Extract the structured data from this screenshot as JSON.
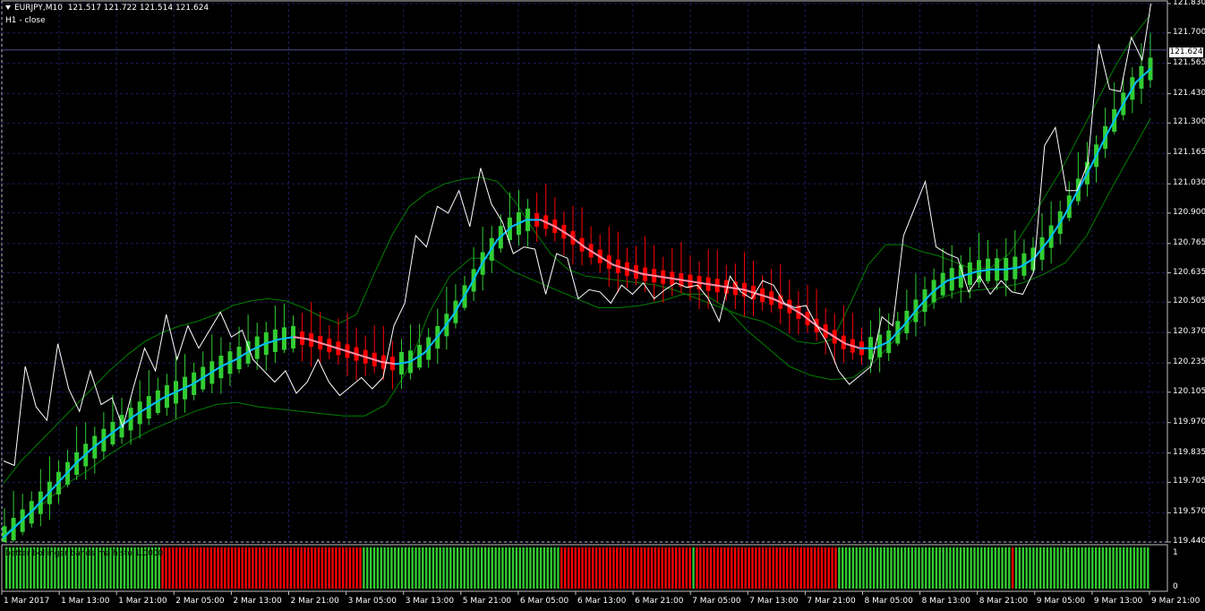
{
  "header": {
    "symbol_line": "EURJPY,M10  121.517 121.722 121.514 121.624",
    "overlay_label": "H1 - close"
  },
  "subwindow": {
    "label": "better bollinger bands ma histo  1.0000",
    "scale_top": "1",
    "scale_bottom": "0"
  },
  "current_price": "121.624",
  "colors": {
    "background": "#000000",
    "grid": "#1c1c5a",
    "bull": "#32cd32",
    "bear": "#ff0000",
    "ma_up": "#00bfff",
    "ma_down": "#ff8fa8",
    "bands": "#008000",
    "close_line": "#ffffff",
    "histo_up": "#32cd32",
    "histo_down": "#ff0000"
  },
  "chart_data": {
    "type": "line",
    "title": "EURJPY,M10",
    "xlabel": "",
    "ylabel": "",
    "ylim": [
      119.44,
      121.83
    ],
    "yticks": [
      "121.830",
      "121.700",
      "121.565",
      "121.430",
      "121.300",
      "121.165",
      "121.030",
      "120.900",
      "120.765",
      "120.635",
      "120.505",
      "120.370",
      "120.235",
      "120.105",
      "119.970",
      "119.835",
      "119.705",
      "119.570",
      "119.440"
    ],
    "xticks": [
      "1 Mar 2017",
      "1 Mar 13:00",
      "1 Mar 21:00",
      "2 Mar 05:00",
      "2 Mar 13:00",
      "2 Mar 21:00",
      "3 Mar 05:00",
      "3 Mar 13:00",
      "5 Mar 21:00",
      "6 Mar 05:00",
      "6 Mar 13:00",
      "6 Mar 21:00",
      "7 Mar 05:00",
      "7 Mar 13:00",
      "7 Mar 21:00",
      "8 Mar 05:00",
      "8 Mar 13:00",
      "8 Mar 21:00",
      "9 Mar 05:00",
      "9 Mar 13:00",
      "9 Mar 21:00"
    ],
    "grid": true,
    "series": [
      {
        "name": "H1 - close",
        "values": [
          119.8,
          119.78,
          120.22,
          120.04,
          119.98,
          120.32,
          120.12,
          120.02,
          120.2,
          120.05,
          120.08,
          119.95,
          120.13,
          120.3,
          120.2,
          120.45,
          120.25,
          120.4,
          120.3,
          120.38,
          120.46,
          120.35,
          120.38,
          120.25,
          120.2,
          120.15,
          120.2,
          120.1,
          120.15,
          120.25,
          120.15,
          120.09,
          120.13,
          120.17,
          120.12,
          120.17,
          120.4,
          120.5,
          120.8,
          120.75,
          120.93,
          120.9,
          121.0,
          120.84,
          121.1,
          120.94,
          120.86,
          120.72,
          120.75,
          120.74,
          120.54,
          120.72,
          120.7,
          120.52,
          120.56,
          120.55,
          120.5,
          120.58,
          120.54,
          120.59,
          120.52,
          120.56,
          120.59,
          120.57,
          120.58,
          120.52,
          120.42,
          120.62,
          120.55,
          120.52,
          120.6,
          120.58,
          120.5,
          120.48,
          120.49,
          120.4,
          120.32,
          120.2,
          120.14,
          120.18,
          120.22,
          120.44,
          120.4,
          120.8,
          120.92,
          121.04,
          120.75,
          120.72,
          120.7,
          120.55,
          120.62,
          120.54,
          120.6,
          120.55,
          120.54,
          120.64,
          121.2,
          121.28,
          121.0,
          121.0,
          121.12,
          121.65,
          121.45,
          121.44,
          121.68,
          121.58,
          121.89,
          121.85
        ]
      },
      {
        "name": "",
        "values": [
          119.46,
          119.52,
          119.58,
          119.65,
          119.72,
          119.79,
          119.85,
          119.9,
          119.95,
          120.0,
          120.04,
          120.08,
          120.11,
          120.14,
          120.18,
          120.22,
          120.25,
          120.29,
          120.32,
          120.34,
          120.35,
          120.34,
          120.32,
          120.3,
          120.28,
          120.26,
          120.24,
          120.23,
          120.24,
          120.28,
          120.36,
          120.45,
          120.56,
          120.68,
          120.78,
          120.84,
          120.87,
          120.87,
          120.84,
          120.8,
          120.75,
          120.71,
          120.67,
          120.65,
          120.63,
          120.62,
          120.61,
          120.6,
          120.59,
          120.58,
          120.57,
          120.56,
          120.54,
          120.52,
          120.49,
          120.45,
          120.4,
          120.36,
          120.32,
          120.3,
          120.3,
          120.33,
          120.4,
          120.48,
          120.55,
          120.6,
          120.62,
          120.64,
          120.65,
          120.65,
          120.66,
          120.7,
          120.78,
          120.88,
          121.0,
          121.12,
          121.25,
          121.37,
          121.48,
          121.54
        ]
      },
      {
        "name": "",
        "values": [
          119.7,
          119.8,
          119.88,
          119.96,
          120.04,
          120.12,
          120.2,
          120.27,
          120.33,
          120.37,
          120.4,
          120.42,
          120.45,
          120.49,
          120.51,
          120.52,
          120.51,
          120.48,
          120.44,
          120.41,
          120.45,
          120.63,
          120.8,
          120.93,
          120.99,
          121.03,
          121.05,
          121.06,
          121.04,
          120.95,
          120.83,
          120.72,
          120.65,
          120.62,
          120.61,
          120.6,
          120.59,
          120.58,
          120.56,
          120.53,
          120.5,
          120.47,
          120.44,
          120.42,
          120.38,
          120.33,
          120.32,
          120.34,
          120.5,
          120.67,
          120.76,
          120.76,
          120.73,
          120.71,
          120.68,
          120.65,
          120.66,
          120.72,
          120.84,
          120.97,
          121.1,
          121.25,
          121.4,
          121.55,
          121.68,
          121.78
        ]
      },
      {
        "name": "",
        "values": [
          119.47,
          119.55,
          119.62,
          119.7,
          119.76,
          119.83,
          119.89,
          119.94,
          119.98,
          120.02,
          120.05,
          120.06,
          120.04,
          120.03,
          120.02,
          120.01,
          120.0,
          120.0,
          120.05,
          120.2,
          120.45,
          120.62,
          120.7,
          120.7,
          120.64,
          120.6,
          120.56,
          120.52,
          120.48,
          120.48,
          120.49,
          120.51,
          120.54,
          120.54,
          120.48,
          120.38,
          120.3,
          120.22,
          120.18,
          120.16,
          120.17,
          120.24,
          120.34,
          120.45,
          120.52,
          120.55,
          120.56,
          120.57,
          120.59,
          120.63,
          120.68,
          120.8,
          120.98,
          121.15,
          121.32
        ]
      },
      {
        "name": "better bollinger bands ma histo",
        "values": [
          1,
          1,
          1,
          1,
          1,
          1,
          1,
          1,
          1,
          1,
          1,
          1,
          1,
          1,
          1,
          1,
          1,
          1,
          1,
          1,
          1,
          1,
          1,
          1,
          1,
          1,
          1,
          1,
          1,
          1,
          1,
          1,
          1,
          1,
          1,
          1,
          1,
          1,
          1,
          1,
          1,
          1,
          1,
          1,
          1,
          0,
          0,
          0,
          0,
          0,
          0,
          0,
          0,
          0,
          0,
          0,
          0,
          0,
          0,
          0,
          0,
          0,
          0,
          0,
          0,
          0,
          0,
          0,
          0,
          0,
          0,
          0,
          0,
          0,
          0,
          0,
          0,
          0,
          0,
          0,
          0,
          0,
          0,
          0,
          0,
          0,
          0,
          0,
          0,
          0,
          0,
          0,
          0,
          0,
          0,
          0,
          0,
          0,
          0,
          0,
          0,
          0,
          0,
          1,
          1,
          1,
          1,
          1,
          1,
          1,
          1,
          1,
          1,
          1,
          1,
          1,
          1,
          1,
          1,
          1,
          1,
          1,
          1,
          1,
          1,
          1,
          1,
          1,
          1,
          1,
          1,
          1,
          1,
          1,
          1,
          1,
          1,
          1,
          1,
          1,
          1,
          1,
          1,
          1,
          1,
          1,
          1,
          1,
          1,
          1,
          1,
          1,
          1,
          1,
          1,
          1,
          1,
          1,
          1,
          1,
          0,
          0,
          0,
          0,
          0,
          0,
          0,
          0,
          0,
          0,
          0,
          0,
          0,
          0,
          0,
          0,
          0,
          0,
          0,
          0,
          0,
          0,
          0,
          0,
          0,
          0,
          0,
          0,
          0,
          0,
          0,
          0,
          0,
          0,
          0,
          0,
          0,
          0,
          1,
          0,
          0,
          0,
          0,
          0,
          0,
          0,
          0,
          0,
          0,
          0,
          0,
          0,
          0,
          0,
          0,
          0,
          0,
          0,
          0,
          0,
          0,
          0,
          0,
          0,
          0,
          0,
          0,
          0,
          0,
          0,
          0,
          0,
          0,
          0,
          0,
          0,
          0,
          0,
          0,
          0,
          1,
          1,
          1,
          1,
          1,
          1,
          1,
          1,
          1,
          1,
          1,
          1,
          1,
          1,
          1,
          1,
          1,
          1,
          1,
          1,
          1,
          1,
          1,
          1,
          1,
          1,
          1,
          1,
          1,
          1,
          1,
          1,
          1,
          1,
          1,
          1,
          1,
          1,
          1,
          1,
          1,
          1,
          1,
          1,
          1,
          1,
          1,
          1,
          1,
          1,
          0,
          1,
          1,
          1,
          1,
          1,
          1,
          1,
          1,
          1,
          1,
          1,
          1,
          1,
          1,
          1,
          1,
          1,
          1,
          1,
          1,
          1,
          1,
          1,
          1,
          1,
          1,
          1,
          1,
          1,
          1,
          1,
          1,
          1,
          1,
          1,
          1,
          1,
          1,
          1
        ]
      }
    ]
  }
}
